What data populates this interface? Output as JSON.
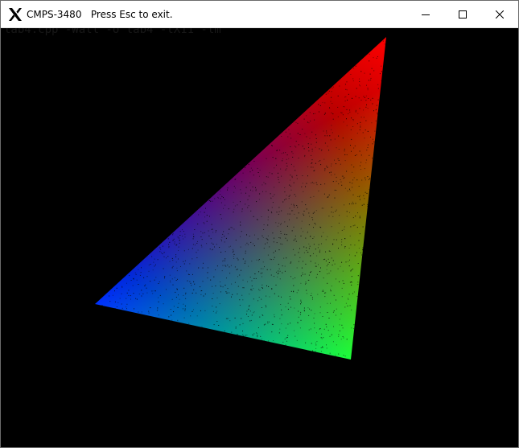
{
  "window": {
    "title": "CMPS-3480   Press Esc to exit.",
    "background_color": "#000000",
    "background_ghost_text": "lab4.cpp -Wall -o lab4 -lX11 -lm"
  },
  "icons": {
    "app": "x11-logo-icon",
    "minimize": "minimize-icon",
    "maximize": "maximize-icon",
    "close": "close-icon"
  },
  "triangle": {
    "description_colors": {
      "top_vertex": "#ff0000",
      "left_vertex": "#0000ff",
      "bottom_vertex": "#00ff00"
    }
  }
}
